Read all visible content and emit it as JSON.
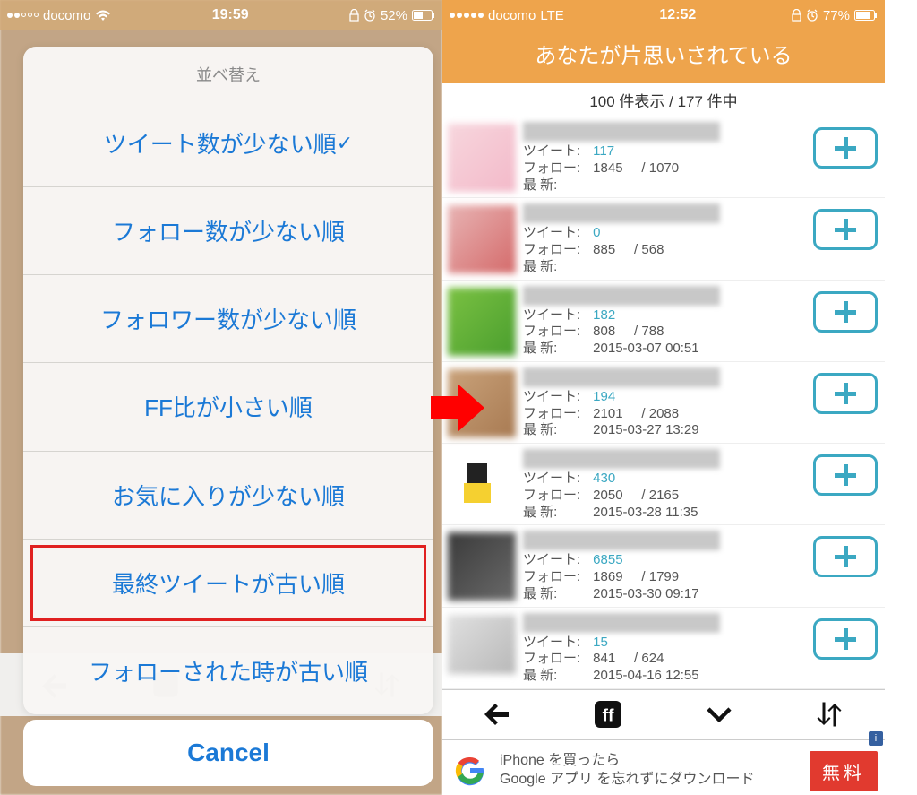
{
  "left": {
    "status": {
      "carrier": "docomo",
      "time": "19:59",
      "battery": "52%"
    },
    "sheet": {
      "title": "並べ替え",
      "items": [
        {
          "label": "ツイート数が少ない順",
          "checked": true
        },
        {
          "label": "フォロー数が少ない順"
        },
        {
          "label": "フォロワー数が少ない順"
        },
        {
          "label": "FF比が小さい順"
        },
        {
          "label": "お気に入りが少ない順"
        },
        {
          "label": "最終ツイートが古い順",
          "highlighted": true
        },
        {
          "label": "フォローされた時が古い順"
        }
      ],
      "cancel": "Cancel"
    }
  },
  "right": {
    "status": {
      "carrier": "docomo",
      "network": "LTE",
      "time": "12:52",
      "battery": "77%"
    },
    "header": "あなたが片思いされている",
    "count": "100 件表示 / 177 件中",
    "labels": {
      "tweet": "ツイート:",
      "follow": "フォロー:",
      "latest": "最 新:"
    },
    "rows": [
      {
        "tweets": "117",
        "follow": "1845",
        "follow2": "1070",
        "latest": ""
      },
      {
        "tweets": "0",
        "follow": "885",
        "follow2": "568",
        "latest": ""
      },
      {
        "tweets": "182",
        "follow": "808",
        "follow2": "788",
        "latest": "2015-03-07 00:51"
      },
      {
        "tweets": "194",
        "follow": "2101",
        "follow2": "2088",
        "latest": "2015-03-27 13:29"
      },
      {
        "tweets": "430",
        "follow": "2050",
        "follow2": "2165",
        "latest": "2015-03-28 11:35"
      },
      {
        "tweets": "6855",
        "follow": "1869",
        "follow2": "1799",
        "latest": "2015-03-30 09:17"
      },
      {
        "tweets": "15",
        "follow": "841",
        "follow2": "624",
        "latest": "2015-04-16 12:55"
      }
    ],
    "ad": {
      "line1": "iPhone を買ったら",
      "line2": "Google アプリ を忘れずにダウンロード",
      "btn": "無料"
    }
  }
}
